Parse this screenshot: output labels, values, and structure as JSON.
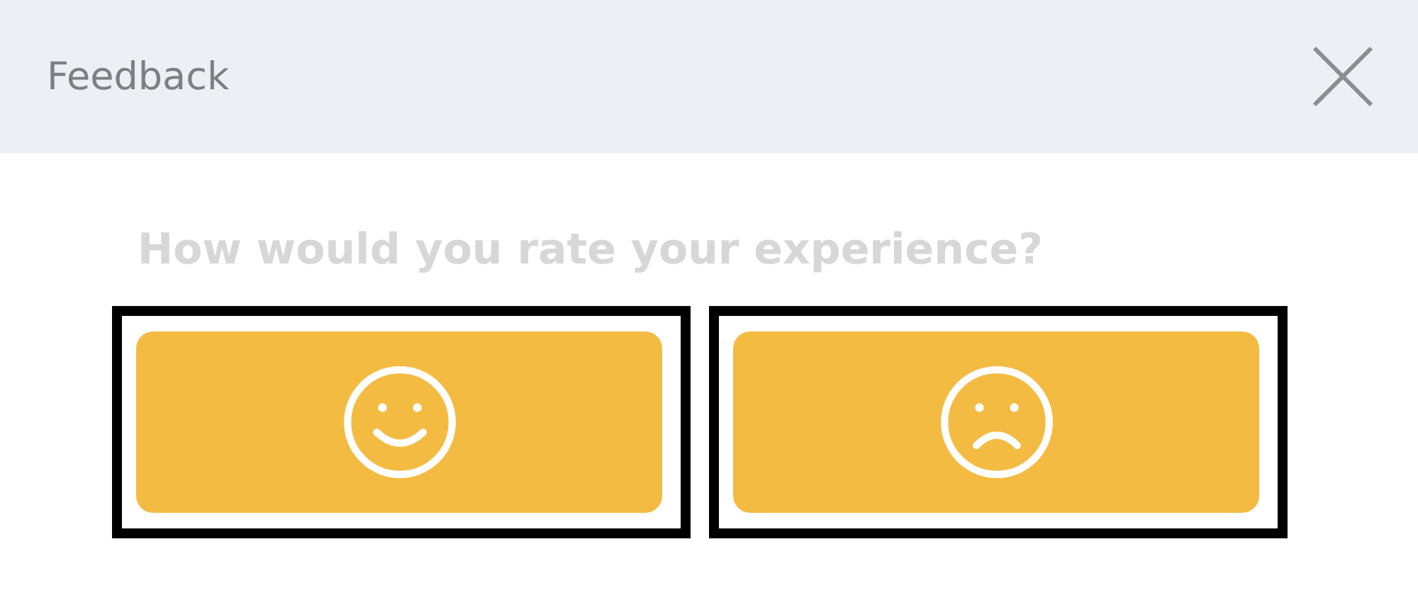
{
  "header": {
    "title": "Feedback"
  },
  "question": "How would you rate your experience?",
  "options": [
    {
      "kind": "happy"
    },
    {
      "kind": "sad"
    }
  ]
}
